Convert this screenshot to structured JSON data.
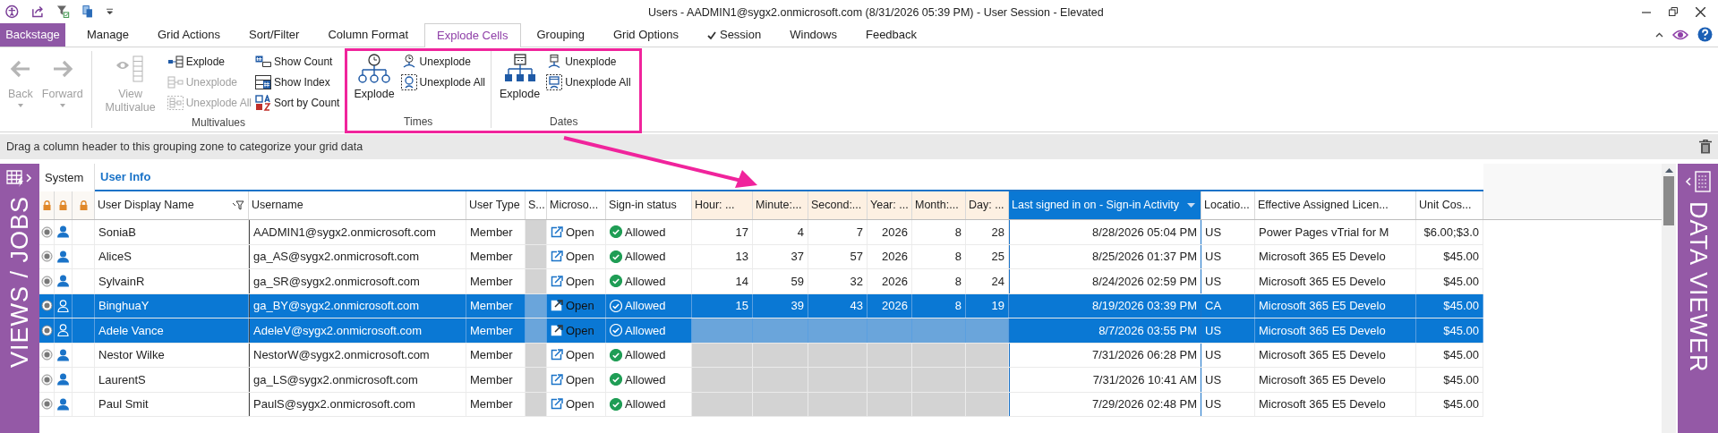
{
  "window": {
    "title": "Users - AADMIN1@sygx2.onmicrosoft.com (8/31/2026 05:39 PM) - User Session - Elevated"
  },
  "backstage": {
    "label": "Backstage"
  },
  "tabs": [
    {
      "label": "Manage",
      "selected": false,
      "checked": false
    },
    {
      "label": "Grid Actions",
      "selected": false,
      "checked": false
    },
    {
      "label": "Sort/Filter",
      "selected": false,
      "checked": false
    },
    {
      "label": "Column Format",
      "selected": false,
      "checked": false
    },
    {
      "label": "Explode Cells",
      "selected": true,
      "checked": false
    },
    {
      "label": "Grouping",
      "selected": false,
      "checked": false
    },
    {
      "label": "Grid Options",
      "selected": false,
      "checked": false
    },
    {
      "label": "Session",
      "selected": false,
      "checked": true
    },
    {
      "label": "Windows",
      "selected": false,
      "checked": false
    },
    {
      "label": "Feedback",
      "selected": false,
      "checked": false
    }
  ],
  "ribbon": {
    "groups": [
      {
        "items": [
          {
            "kind": "large",
            "label": "Back",
            "disabled": true,
            "dropdown": true
          },
          {
            "kind": "large",
            "label": "Forward",
            "disabled": true,
            "dropdown": true
          }
        ]
      },
      {
        "label": "Multivalues",
        "items": [
          {
            "kind": "large",
            "label": "View Multivalue",
            "disabled": true,
            "dropdown": false
          },
          {
            "kind": "small",
            "label": "Explode",
            "disabled": false
          },
          {
            "kind": "small",
            "label": "Unexplode",
            "disabled": true
          },
          {
            "kind": "small",
            "label": "Unexplode All",
            "disabled": true
          },
          {
            "kind": "small",
            "label": "Show Count",
            "disabled": false
          },
          {
            "kind": "small",
            "label": "Show Index",
            "disabled": false
          },
          {
            "kind": "small",
            "label": "Sort by Count",
            "disabled": false
          }
        ]
      },
      {
        "label": "Times",
        "items": [
          {
            "kind": "large",
            "label": "Explode",
            "disabled": false,
            "dropdown": false
          },
          {
            "kind": "small",
            "label": "Unexplode",
            "disabled": false
          },
          {
            "kind": "small",
            "label": "Unexplode All",
            "disabled": false
          }
        ]
      },
      {
        "label": "Dates",
        "items": [
          {
            "kind": "large",
            "label": "Explode",
            "disabled": false,
            "dropdown": false
          },
          {
            "kind": "small",
            "label": "Unexplode",
            "disabled": false
          },
          {
            "kind": "small",
            "label": "Unexplode All",
            "disabled": false
          }
        ]
      }
    ]
  },
  "grouping_zone": {
    "hint": "Drag a column header to this grouping zone to categorize your grid data"
  },
  "left_panel": {
    "label": "VIEWS / JOBS"
  },
  "right_panel": {
    "label": "DATA VIEWER"
  },
  "grid": {
    "bands": [
      {
        "label": "System",
        "selected": false
      },
      {
        "label": "User Info",
        "selected": true
      }
    ],
    "columns": [
      {
        "kind": "lock",
        "selected": false,
        "filtered": false,
        "exploded": false,
        "sorted": false
      },
      {
        "kind": "lock",
        "selected": false,
        "filtered": false,
        "exploded": false,
        "sorted": false
      },
      {
        "kind": "lock",
        "selected": false,
        "filtered": false,
        "exploded": false,
        "sorted": false
      },
      {
        "kind": "text",
        "label": "User Display Name",
        "selected": false,
        "filtered": true,
        "exploded": false,
        "sorted": false
      },
      {
        "kind": "text",
        "label": "Username",
        "selected": false,
        "filtered": false,
        "exploded": false,
        "sorted": false
      },
      {
        "kind": "text",
        "label": "User Type",
        "selected": false,
        "filtered": false,
        "exploded": false,
        "sorted": false
      },
      {
        "kind": "blank",
        "label": "S...",
        "selected": false,
        "filtered": false,
        "exploded": false,
        "sorted": false
      },
      {
        "kind": "link",
        "label": "Microso...",
        "selected": false,
        "filtered": false,
        "exploded": false,
        "sorted": false
      },
      {
        "kind": "status",
        "label": "Sign-in status",
        "selected": false,
        "filtered": false,
        "exploded": false,
        "sorted": false
      },
      {
        "kind": "number",
        "label": "Hour: ...",
        "selected": false,
        "filtered": false,
        "exploded": true,
        "sorted": false
      },
      {
        "kind": "number",
        "label": "Minute:...",
        "selected": false,
        "filtered": false,
        "exploded": true,
        "sorted": false
      },
      {
        "kind": "number",
        "label": "Second:...",
        "selected": false,
        "filtered": false,
        "exploded": true,
        "sorted": false
      },
      {
        "kind": "number",
        "label": "Year: ...",
        "selected": false,
        "filtered": false,
        "exploded": true,
        "sorted": false
      },
      {
        "kind": "number",
        "label": "Month:...",
        "selected": false,
        "filtered": false,
        "exploded": true,
        "sorted": false
      },
      {
        "kind": "number",
        "label": "Day: ...",
        "selected": false,
        "filtered": false,
        "exploded": true,
        "sorted": false
      },
      {
        "kind": "number",
        "label": "Last signed in on - Sign-in Activity",
        "selected": true,
        "filtered": false,
        "exploded": false,
        "sorted": true
      },
      {
        "kind": "text",
        "label": "Locatio...",
        "selected": false,
        "filtered": false,
        "exploded": false,
        "sorted": false
      },
      {
        "kind": "text",
        "label": "Effective Assigned Licen...",
        "selected": false,
        "filtered": false,
        "exploded": false,
        "sorted": false
      },
      {
        "kind": "number",
        "label": "Unit Cos...",
        "selected": false,
        "filtered": false,
        "exploded": false,
        "sorted": false
      }
    ],
    "rows": [
      {
        "selected": false,
        "cells": [
          "",
          "",
          "",
          "SoniaB",
          "AADMIN1@sygx2.onmicrosoft.com",
          "Member",
          "",
          "Open",
          "Allowed",
          "17",
          "4",
          "7",
          "2026",
          "8",
          "28",
          "8/28/2026 05:04 PM",
          "US",
          "Power Pages vTrial for M",
          "$6.00;$3.0"
        ]
      },
      {
        "selected": false,
        "cells": [
          "",
          "",
          "",
          "AliceS",
          "ga_AS@sygx2.onmicrosoft.com",
          "Member",
          "",
          "Open",
          "Allowed",
          "13",
          "37",
          "57",
          "2026",
          "8",
          "25",
          "8/25/2026 01:37 PM",
          "US",
          "Microsoft 365 E5 Develo",
          "$45.00"
        ]
      },
      {
        "selected": false,
        "cells": [
          "",
          "",
          "",
          "SylvainR",
          "ga_SR@sygx2.onmicrosoft.com",
          "Member",
          "",
          "Open",
          "Allowed",
          "14",
          "59",
          "32",
          "2026",
          "8",
          "24",
          "8/24/2026 02:59 PM",
          "US",
          "Microsoft 365 E5 Develo",
          "$45.00"
        ]
      },
      {
        "selected": true,
        "cells": [
          "",
          "",
          "",
          "BinghuaY",
          "ga_BY@sygx2.onmicrosoft.com",
          "Member",
          "",
          "Open",
          "Allowed",
          "15",
          "39",
          "43",
          "2026",
          "8",
          "19",
          "8/19/2026 03:39 PM",
          "CA",
          "Microsoft 365 E5 Develo",
          "$45.00"
        ]
      },
      {
        "selected": true,
        "cells": [
          "",
          "",
          "",
          "Adele Vance",
          "AdeleV@sygx2.onmicrosoft.com",
          "Member",
          "",
          "Open",
          "Allowed",
          "",
          "",
          "",
          "",
          "",
          "",
          "8/7/2026 03:55 PM",
          "US",
          "Microsoft 365 E5 Develo",
          "$45.00"
        ]
      },
      {
        "selected": false,
        "cells": [
          "",
          "",
          "",
          "Nestor Wilke",
          "NestorW@sygx2.onmicrosoft.com",
          "Member",
          "",
          "Open",
          "Allowed",
          "",
          "",
          "",
          "",
          "",
          "",
          "7/31/2026 06:28 PM",
          "US",
          "Microsoft 365 E5 Develo",
          "$45.00"
        ]
      },
      {
        "selected": false,
        "cells": [
          "",
          "",
          "",
          "LaurentS",
          "ga_LS@sygx2.onmicrosoft.com",
          "Member",
          "",
          "Open",
          "Allowed",
          "",
          "",
          "",
          "",
          "",
          "",
          "7/31/2026 10:41 AM",
          "US",
          "Microsoft 365 E5 Develo",
          "$45.00"
        ]
      },
      {
        "selected": false,
        "cells": [
          "",
          "",
          "",
          "Paul Smit",
          "PaulS@sygx2.onmicrosoft.com",
          "Member",
          "",
          "Open",
          "Allowed",
          "",
          "",
          "",
          "",
          "",
          "",
          "7/29/2026 02:48 PM",
          "US",
          "Microsoft 365 E5 Develo",
          "$45.00"
        ]
      }
    ]
  }
}
